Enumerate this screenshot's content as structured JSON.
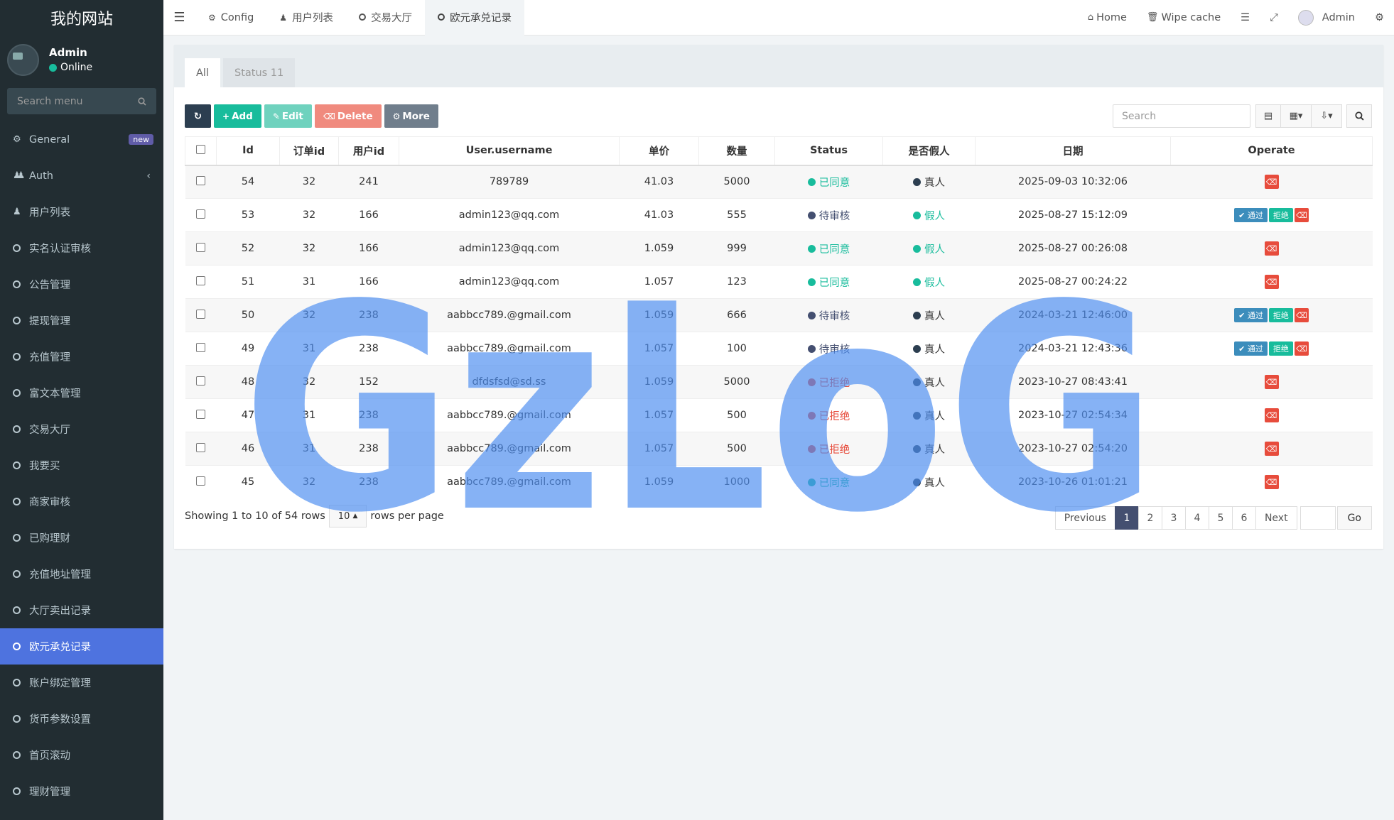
{
  "brand": "我的网站",
  "user": {
    "name": "Admin",
    "status": "Online"
  },
  "sidebar": {
    "search_placeholder": "Search menu",
    "badge": "new",
    "items": [
      {
        "label": "General",
        "icon": "cogs-icon"
      },
      {
        "label": "Auth",
        "icon": "users-icon"
      },
      {
        "label": "用户列表",
        "icon": "user-icon"
      },
      {
        "label": "实名认证审核",
        "icon": "circle-icon"
      },
      {
        "label": "公告管理",
        "icon": "circle-icon"
      },
      {
        "label": "提现管理",
        "icon": "circle-icon"
      },
      {
        "label": "充值管理",
        "icon": "circle-icon"
      },
      {
        "label": "富文本管理",
        "icon": "circle-icon"
      },
      {
        "label": "交易大厅",
        "icon": "circle-icon"
      },
      {
        "label": "我要买",
        "icon": "circle-icon"
      },
      {
        "label": "商家审核",
        "icon": "circle-icon"
      },
      {
        "label": "已购理财",
        "icon": "circle-icon"
      },
      {
        "label": "充值地址管理",
        "icon": "circle-icon"
      },
      {
        "label": "大厅卖出记录",
        "icon": "circle-icon"
      },
      {
        "label": "欧元承兑记录",
        "icon": "circle-icon"
      },
      {
        "label": "账户绑定管理",
        "icon": "circle-icon"
      },
      {
        "label": "货币参数设置",
        "icon": "circle-icon"
      },
      {
        "label": "首页滚动",
        "icon": "circle-icon"
      },
      {
        "label": "理财管理",
        "icon": "circle-icon"
      }
    ]
  },
  "topnav": {
    "tabs": [
      {
        "label": "Config"
      },
      {
        "label": "用户列表"
      },
      {
        "label": "交易大厅"
      },
      {
        "label": "欧元承兑记录"
      }
    ],
    "home": "Home",
    "wipe_cache": "Wipe cache",
    "admin": "Admin"
  },
  "panel": {
    "tabs": [
      "All",
      "Status 11"
    ]
  },
  "toolbar": {
    "add": "Add",
    "edit": "Edit",
    "delete": "Delete",
    "more": "More",
    "search_placeholder": "Search"
  },
  "table": {
    "headers": [
      "Id",
      "订单id",
      "用户id",
      "User.username",
      "单价",
      "数量",
      "Status",
      "是否假人",
      "日期",
      "Operate"
    ],
    "pass_label": "通过",
    "reject_label": "拒绝",
    "rows": [
      {
        "id": "54",
        "order": "32",
        "uid": "241",
        "username": "789789",
        "price": "41.03",
        "qty": "5000",
        "status": "已同意",
        "fake": "真人",
        "date": "2025-09-03 10:32:06"
      },
      {
        "id": "53",
        "order": "32",
        "uid": "166",
        "username": "admin123@qq.com",
        "price": "41.03",
        "qty": "555",
        "status": "待审核",
        "fake": "假人",
        "date": "2025-08-27 15:12:09"
      },
      {
        "id": "52",
        "order": "32",
        "uid": "166",
        "username": "admin123@qq.com",
        "price": "1.059",
        "qty": "999",
        "status": "已同意",
        "fake": "假人",
        "date": "2025-08-27 00:26:08"
      },
      {
        "id": "51",
        "order": "31",
        "uid": "166",
        "username": "admin123@qq.com",
        "price": "1.057",
        "qty": "123",
        "status": "已同意",
        "fake": "假人",
        "date": "2025-08-27 00:24:22"
      },
      {
        "id": "50",
        "order": "32",
        "uid": "238",
        "username": "aabbcc789.@gmail.com",
        "price": "1.059",
        "qty": "666",
        "status": "待审核",
        "fake": "真人",
        "date": "2024-03-21 12:46:00"
      },
      {
        "id": "49",
        "order": "31",
        "uid": "238",
        "username": "aabbcc789.@gmail.com",
        "price": "1.057",
        "qty": "100",
        "status": "待审核",
        "fake": "真人",
        "date": "2024-03-21 12:43:36"
      },
      {
        "id": "48",
        "order": "32",
        "uid": "152",
        "username": "dfdsfsd@sd.ss",
        "price": "1.059",
        "qty": "5000",
        "status": "已拒绝",
        "fake": "真人",
        "date": "2023-10-27 08:43:41"
      },
      {
        "id": "47",
        "order": "31",
        "uid": "238",
        "username": "aabbcc789.@gmail.com",
        "price": "1.057",
        "qty": "500",
        "status": "已拒绝",
        "fake": "真人",
        "date": "2023-10-27 02:54:34"
      },
      {
        "id": "46",
        "order": "31",
        "uid": "238",
        "username": "aabbcc789.@gmail.com",
        "price": "1.057",
        "qty": "500",
        "status": "已拒绝",
        "fake": "真人",
        "date": "2023-10-27 02:54:20"
      },
      {
        "id": "45",
        "order": "32",
        "uid": "238",
        "username": "aabbcc789.@gmail.com",
        "price": "1.059",
        "qty": "1000",
        "status": "已同意",
        "fake": "真人",
        "date": "2023-10-26 01:01:21"
      }
    ]
  },
  "footer": {
    "showing": "Showing 1 to 10 of 54 rows",
    "page_size": "10",
    "rows_per_page": "rows per page",
    "prev": "Previous",
    "next": "Next",
    "pages": [
      "1",
      "2",
      "3",
      "4",
      "5",
      "6"
    ],
    "go": "Go"
  },
  "watermark": "GzLoG",
  "colors": {
    "approved": "#18bc9c",
    "pending": "#444f70",
    "rejected": "#e74c3c",
    "real": "#2c3e50",
    "fake": "#18bc9c",
    "active_menu": "#4e73df",
    "online": "#18bc9c"
  }
}
